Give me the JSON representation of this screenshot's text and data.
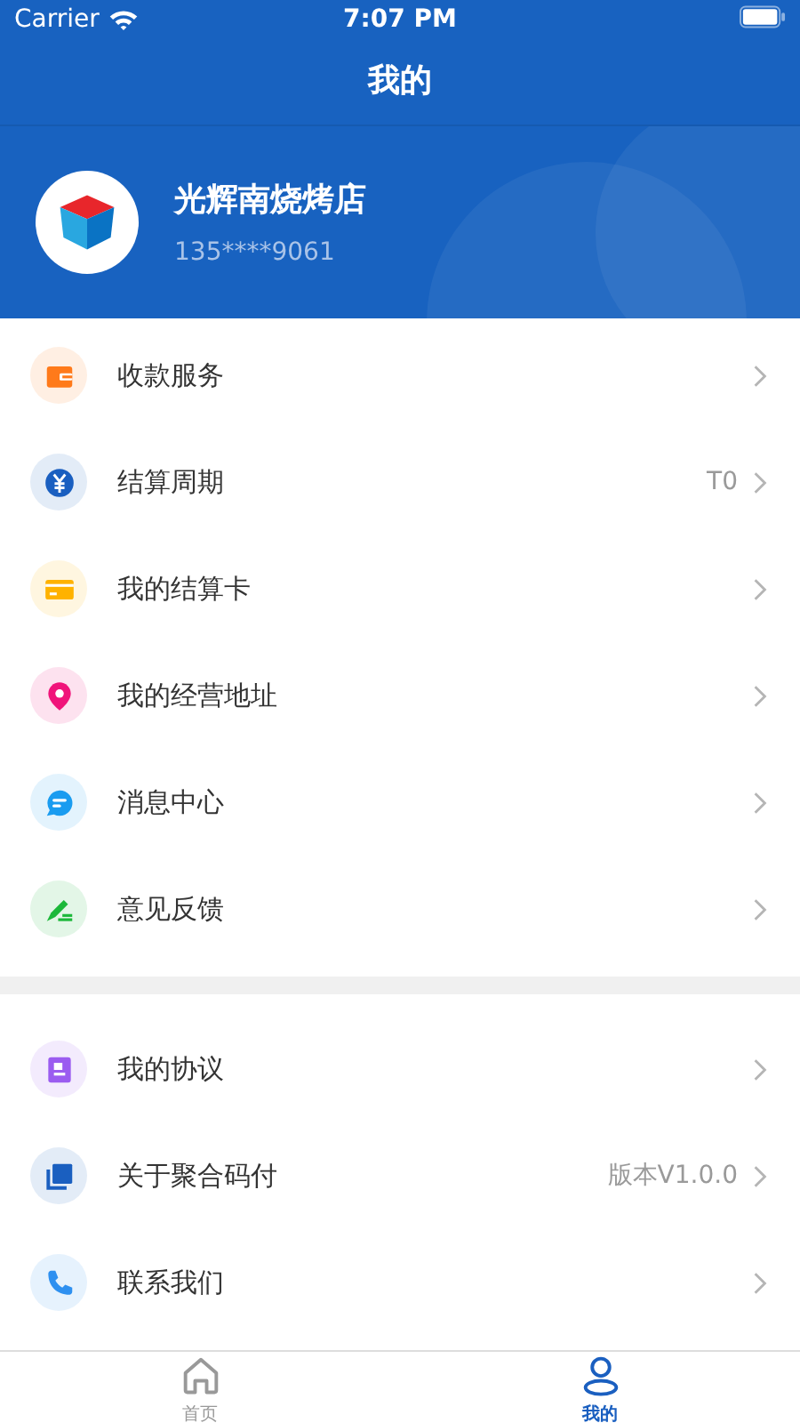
{
  "status_bar": {
    "carrier": "Carrier",
    "time": "7:07 PM"
  },
  "nav": {
    "title": "我的"
  },
  "profile": {
    "name": "光辉南烧烤店",
    "phone": "135****9061"
  },
  "sections": [
    {
      "items": [
        {
          "kind": "wallet",
          "color": "#ff7a1a",
          "label": "收款服务"
        },
        {
          "kind": "yuan",
          "color": "#1a5fc0",
          "label": "结算周期",
          "value": "T0"
        },
        {
          "kind": "card",
          "color": "#ffb200",
          "label": "我的结算卡"
        },
        {
          "kind": "pin",
          "color": "#f0147a",
          "label": "我的经营地址"
        },
        {
          "kind": "chat",
          "color": "#1a9cf0",
          "label": "消息中心"
        },
        {
          "kind": "pen",
          "color": "#1cb83a",
          "label": "意见反馈"
        }
      ]
    },
    {
      "items": [
        {
          "kind": "doc",
          "color": "#9b5cf0",
          "label": "我的协议"
        },
        {
          "kind": "layers",
          "color": "#1a5fc0",
          "label": "关于聚合码付",
          "value": "版本V1.0.0"
        },
        {
          "kind": "phone",
          "color": "#2e90f0",
          "label": "联系我们"
        }
      ]
    }
  ],
  "tabs": [
    {
      "kind": "home",
      "label": "首页",
      "selected": false
    },
    {
      "kind": "person",
      "label": "我的",
      "selected": true
    }
  ]
}
